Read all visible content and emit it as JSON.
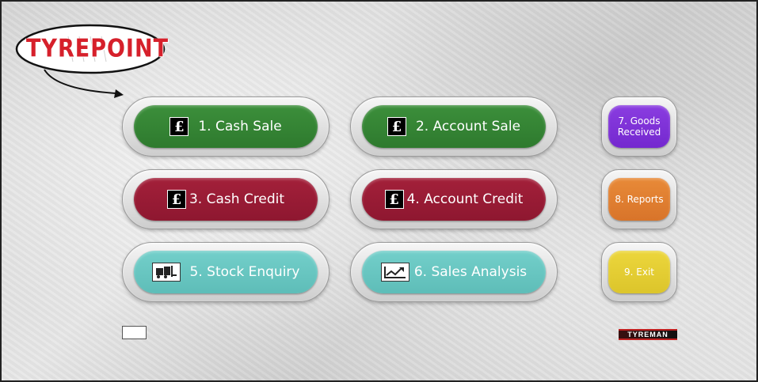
{
  "logo": {
    "text": "TYREPOINT"
  },
  "buttons": {
    "cash_sale": "1. Cash Sale",
    "account_sale": "2. Account Sale",
    "cash_credit": "3. Cash Credit",
    "account_credit": "4. Account Credit",
    "stock_enquiry": "5. Stock Enquiry",
    "sales_analysis": "6. Sales Analysis",
    "goods_received_1": "7. Goods",
    "goods_received_2": "Received",
    "reports": "8. Reports",
    "exit": "9. Exit"
  },
  "icons": {
    "pound": "£",
    "stock": "forklift-icon",
    "analysis": "chart-trend-icon"
  },
  "colors": {
    "green": "#2e7a2e",
    "red": "#8e1730",
    "teal": "#5ebdb8",
    "purple": "#7428cf",
    "orange": "#d8742a",
    "yellow": "#dcc52b",
    "logo_red": "#d6202b"
  },
  "footer": {
    "brand": "TYREMAN"
  }
}
